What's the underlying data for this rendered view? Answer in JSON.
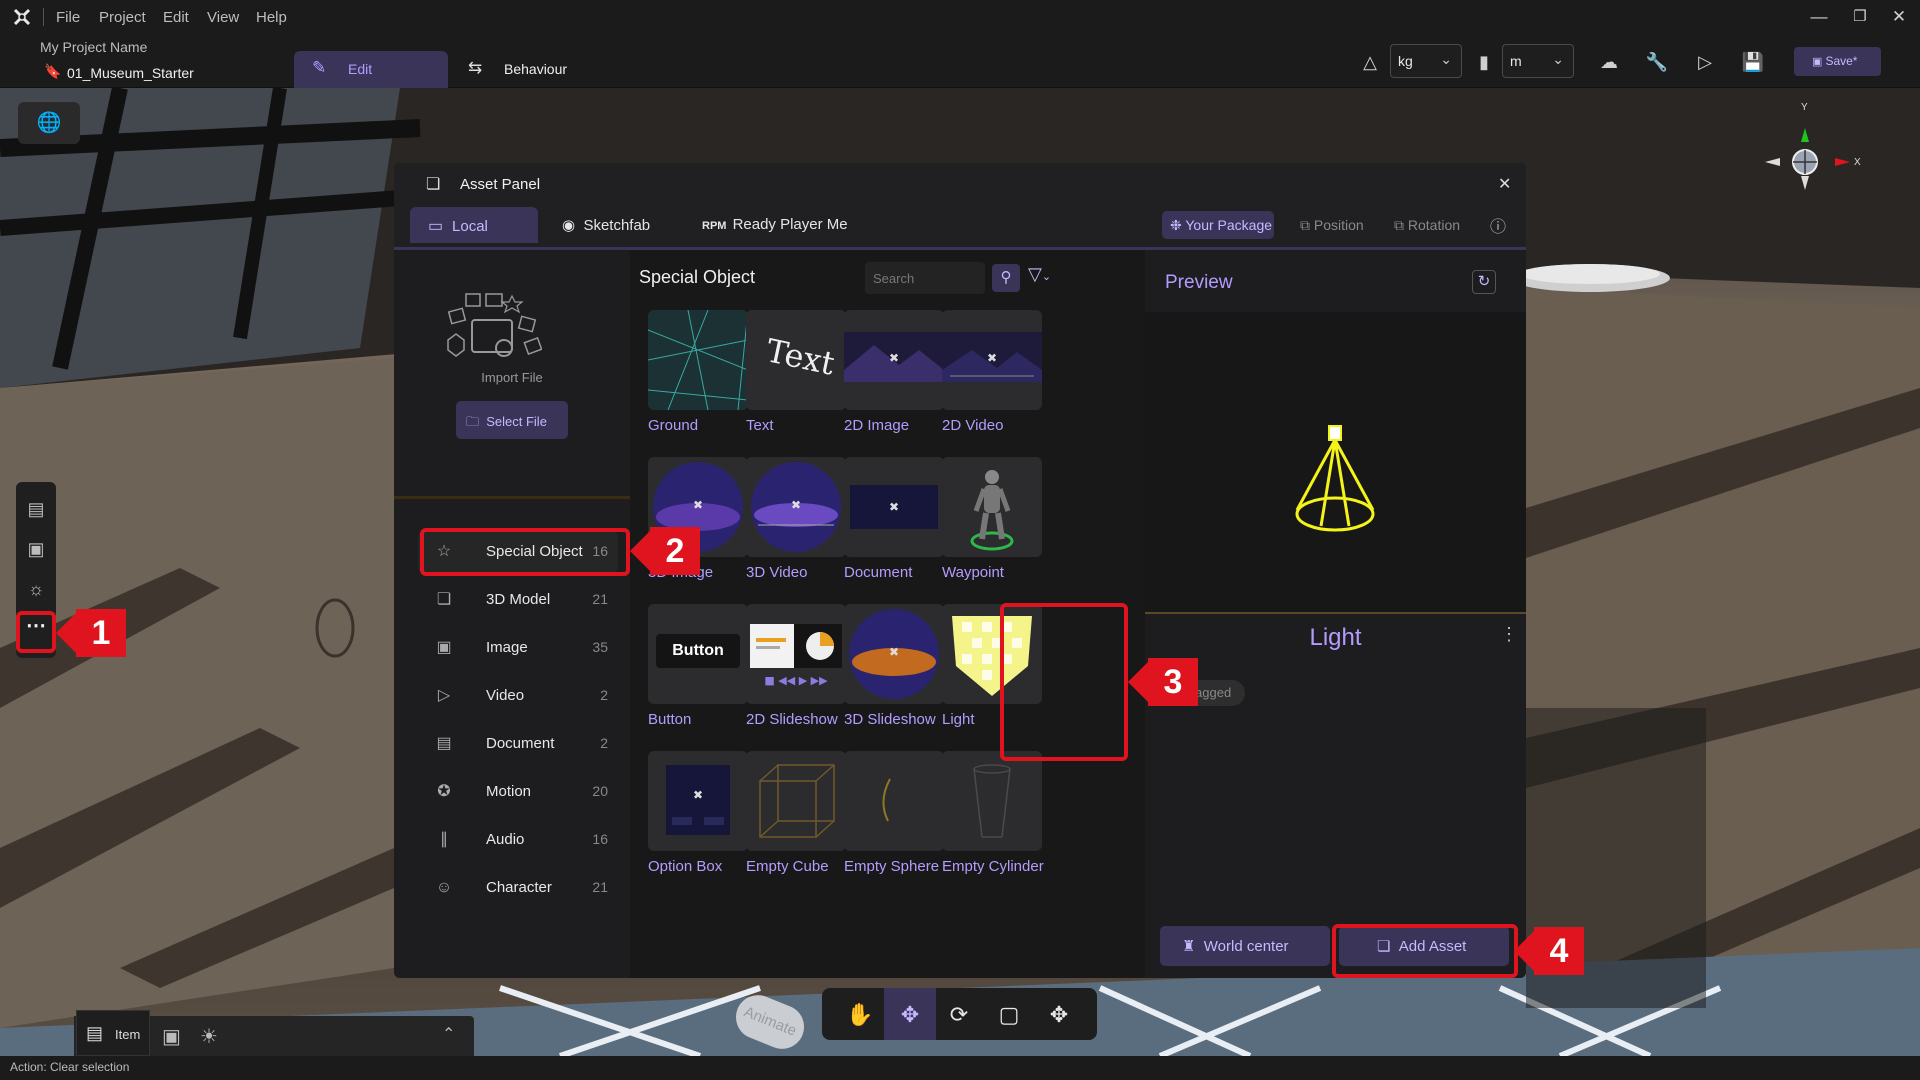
{
  "menu": [
    "File",
    "Project",
    "View",
    "Help"
  ],
  "menu_edit": "Edit",
  "project": {
    "name": "My Project Name",
    "scene": "01_Museum_Starter"
  },
  "modes": {
    "edit": "Edit",
    "behaviour": "Behaviour"
  },
  "units": {
    "mass": "kg",
    "length": "m"
  },
  "save_label": "Save*",
  "gizmo": {
    "y": "Y",
    "x": "X"
  },
  "asset_panel": {
    "title": "Asset Panel",
    "tabs": {
      "local": "Local",
      "sketchfab": "Sketchfab",
      "rpm": "Ready Player Me"
    },
    "pills": {
      "your_package": "Your Package",
      "position": "Position",
      "rotation": "Rotation"
    },
    "import": {
      "label": "Import File",
      "button": "Select File"
    },
    "categories": [
      {
        "label": "Special Object",
        "count": "16"
      },
      {
        "label": "3D Model",
        "count": "21"
      },
      {
        "label": "Image",
        "count": "35"
      },
      {
        "label": "Video",
        "count": "2"
      },
      {
        "label": "Document",
        "count": "2"
      },
      {
        "label": "Motion",
        "count": "20"
      },
      {
        "label": "Audio",
        "count": "16"
      },
      {
        "label": "Character",
        "count": "21"
      }
    ],
    "grid": {
      "title": "Special Object",
      "search_placeholder": "Search",
      "items": [
        "Ground",
        "Text",
        "2D Image",
        "2D Video",
        "3D Image",
        "3D Video",
        "Document",
        "Waypoint",
        "Button",
        "2D Slideshow",
        "3D Slideshow",
        "Light",
        "Option Box",
        "Empty Cube",
        "Empty Sphere",
        "Empty Cylinder"
      ],
      "thumb_text": {
        "text": "Text",
        "button": "Button"
      }
    },
    "preview": {
      "title": "Preview",
      "selected": "Light",
      "tag": "Untagged",
      "world_center": "World center",
      "add_asset": "Add Asset"
    }
  },
  "callouts": [
    "1",
    "2",
    "3",
    "4"
  ],
  "bottom": {
    "item_tab": "Item",
    "animate": "Animate"
  },
  "status": "Action: Clear selection",
  "colors": {
    "accent": "#b49cff",
    "panel": "#1d1d1f",
    "highlight": "#e0141e",
    "tab_active": "#3a3458"
  }
}
